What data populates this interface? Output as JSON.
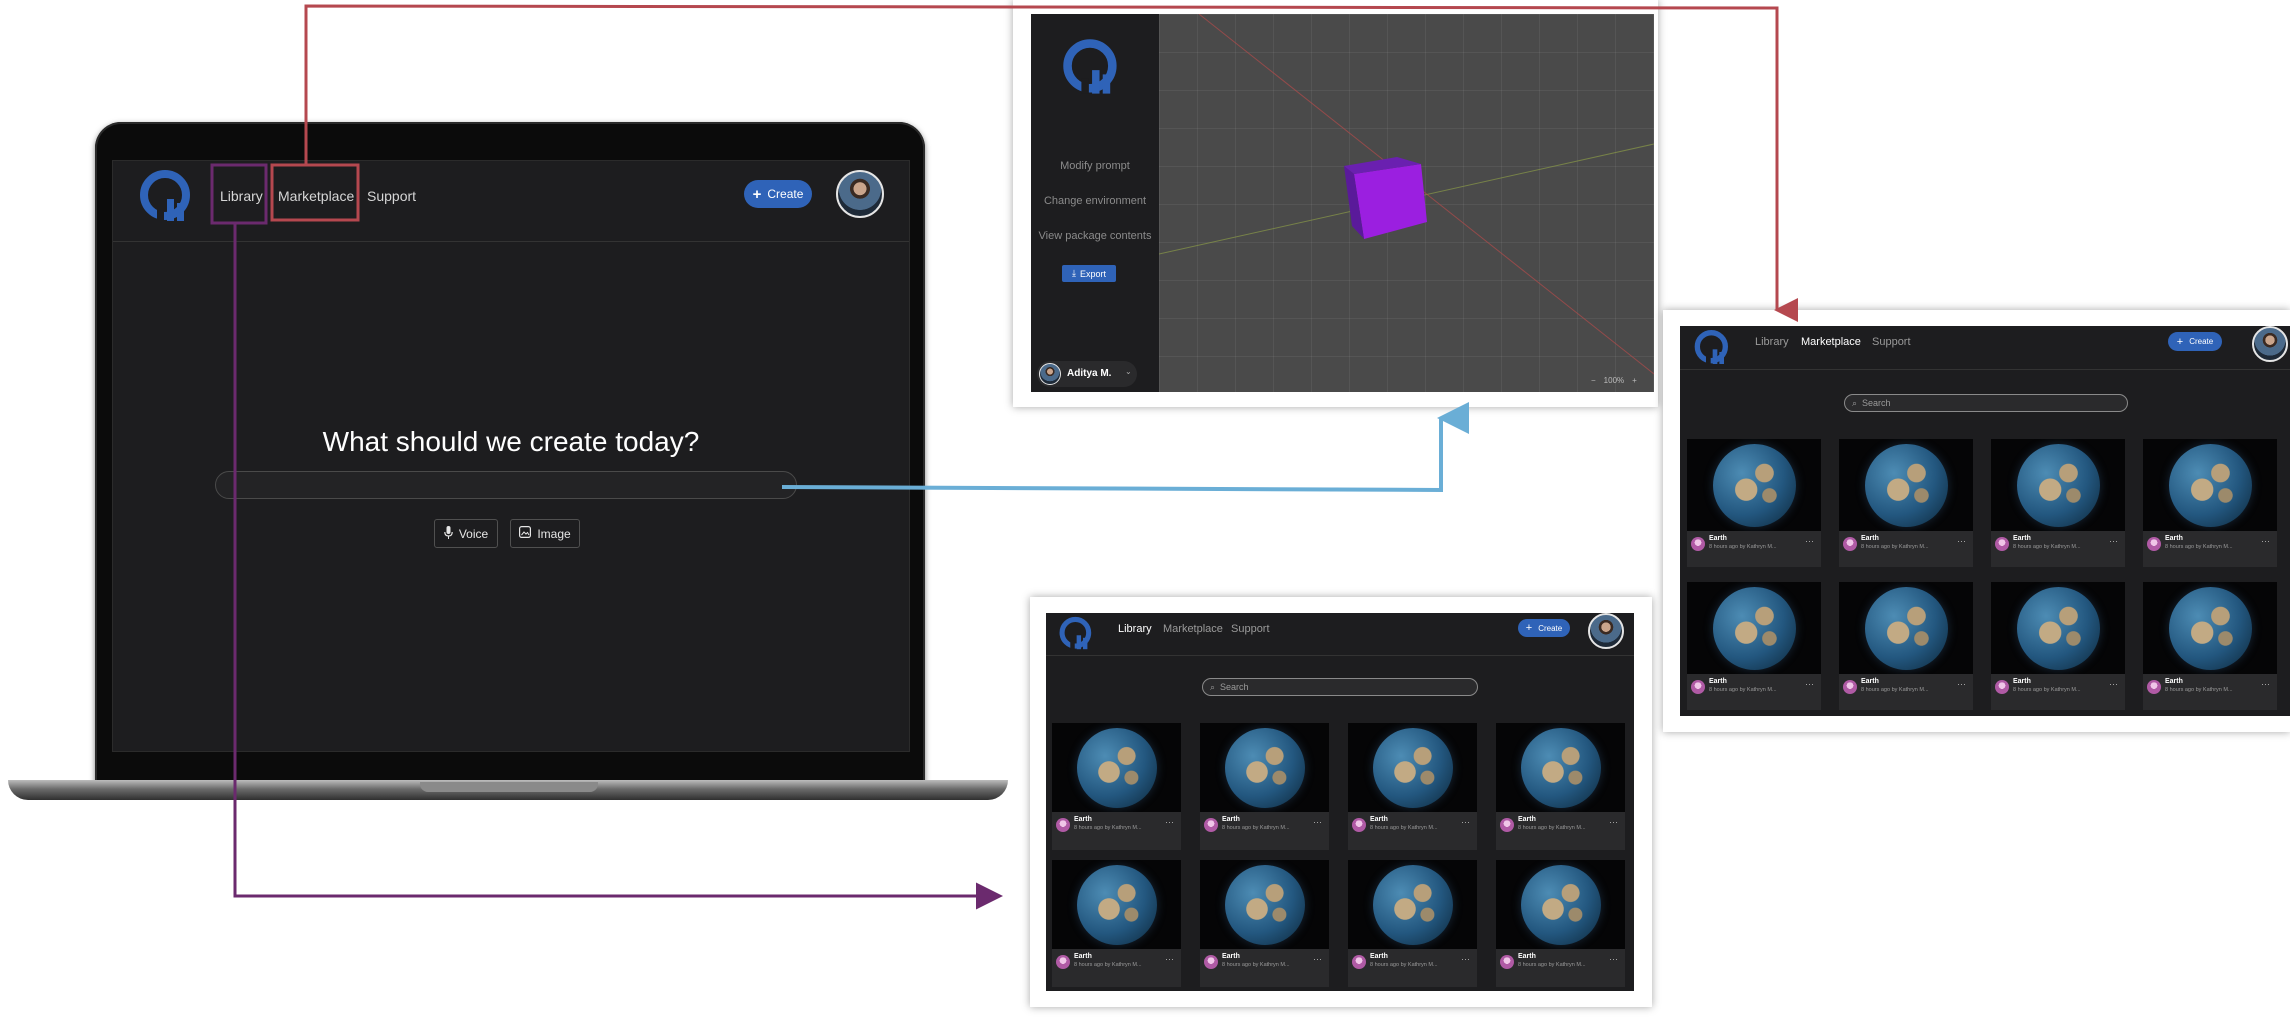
{
  "brand": {
    "logo_icon": "q-logo-icon",
    "logo_color": "#2f63b8"
  },
  "home": {
    "nav": {
      "library": "Library",
      "marketplace": "Marketplace",
      "support": "Support"
    },
    "create_label": "Create",
    "headline": "What should we create today?",
    "prompt_placeholder": "",
    "voice_label": "Voice",
    "image_label": "Image"
  },
  "editor": {
    "menu": [
      "Modify prompt",
      "Change environment",
      "View package contents"
    ],
    "export_label": "Export",
    "user_name": "Aditya M.",
    "zoom_label": "100%",
    "cube_color": "#9b1fe0"
  },
  "marketplace": {
    "nav": {
      "library": "Library",
      "marketplace": "Marketplace",
      "support": "Support"
    },
    "create_label": "Create",
    "search_placeholder": "Search",
    "items": [
      {
        "title": "Earth",
        "subtitle": "8 hours ago by Kathryn M..."
      },
      {
        "title": "Earth",
        "subtitle": "8 hours ago by Kathryn M..."
      },
      {
        "title": "Earth",
        "subtitle": "8 hours ago by Kathryn M..."
      },
      {
        "title": "Earth",
        "subtitle": "8 hours ago by Kathryn M..."
      },
      {
        "title": "Earth",
        "subtitle": "8 hours ago by Kathryn M..."
      },
      {
        "title": "Earth",
        "subtitle": "8 hours ago by Kathryn M..."
      },
      {
        "title": "Earth",
        "subtitle": "8 hours ago by Kathryn M..."
      },
      {
        "title": "Earth",
        "subtitle": "8 hours ago by Kathryn M..."
      }
    ]
  },
  "library": {
    "nav": {
      "library": "Library",
      "marketplace": "Marketplace",
      "support": "Support"
    },
    "create_label": "Create",
    "search_placeholder": "Search",
    "items": [
      {
        "title": "Earth",
        "subtitle": "8 hours ago by Kathryn M..."
      },
      {
        "title": "Earth",
        "subtitle": "8 hours ago by Kathryn M..."
      },
      {
        "title": "Earth",
        "subtitle": "8 hours ago by Kathryn M..."
      },
      {
        "title": "Earth",
        "subtitle": "8 hours ago by Kathryn M..."
      },
      {
        "title": "Earth",
        "subtitle": "8 hours ago by Kathryn M..."
      },
      {
        "title": "Earth",
        "subtitle": "8 hours ago by Kathryn M..."
      },
      {
        "title": "Earth",
        "subtitle": "8 hours ago by Kathryn M..."
      },
      {
        "title": "Earth",
        "subtitle": "8 hours ago by Kathryn M..."
      }
    ]
  },
  "flow_colors": {
    "marketplace_arrow": "#b5484f",
    "prompt_arrow": "#6aaed6",
    "library_arrow": "#6b2a6e"
  }
}
